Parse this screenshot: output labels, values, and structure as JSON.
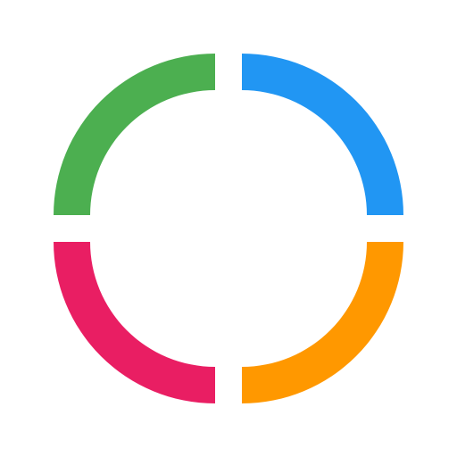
{
  "logo": {
    "segments": [
      {
        "name": "top-left-arc",
        "color": "#4CAF50"
      },
      {
        "name": "top-right-arc",
        "color": "#2196F3"
      },
      {
        "name": "bottom-left-arc",
        "color": "#E91E63"
      },
      {
        "name": "bottom-right-arc",
        "color": "#FF9800"
      }
    ],
    "background": "#FFFFFF"
  }
}
